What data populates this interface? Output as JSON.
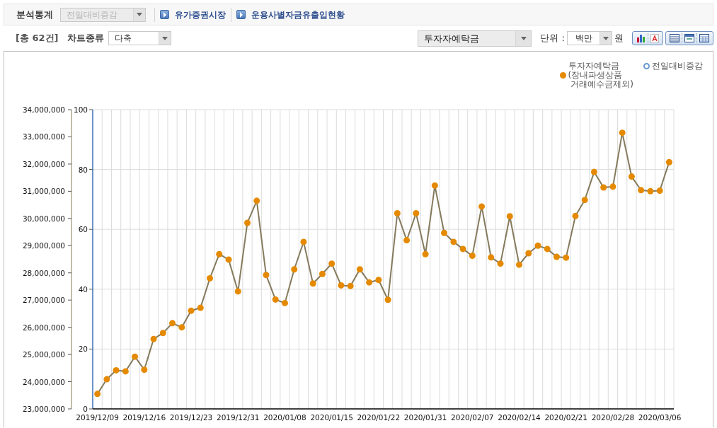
{
  "toolbar": {
    "label": "분석통계",
    "stat_select": {
      "value": "전일대비증감",
      "disabled": true
    },
    "links": [
      "유가증권시장",
      "운용사별자금유출입현황"
    ]
  },
  "controls": {
    "count": "[총 62건]",
    "chart_type_label": "차트종류",
    "chart_type": "다축",
    "metric": "투자자예탁금",
    "unit_label": "단위 :",
    "unit": "백만",
    "currency": "원"
  },
  "chart": {
    "legend": [
      {
        "kind": "hollow",
        "label": "전일대비증감",
        "color": "#6a9ad0"
      }
    ],
    "chart_data": {
      "type": "line",
      "grid": true,
      "categories": [
        "2019/12/09",
        null,
        null,
        null,
        null,
        "2019/12/16",
        null,
        null,
        null,
        null,
        "2019/12/23",
        null,
        null,
        null,
        null,
        "2019/12/31",
        null,
        null,
        null,
        null,
        "2020/01/08",
        null,
        null,
        null,
        null,
        "2020/01/15",
        null,
        null,
        null,
        null,
        "2020/01/22",
        null,
        null,
        null,
        null,
        "2020/01/31",
        null,
        null,
        null,
        null,
        "2020/02/07",
        null,
        null,
        null,
        null,
        "2020/02/14",
        null,
        null,
        null,
        null,
        "2020/02/21",
        null,
        null,
        null,
        null,
        "2020/02/28",
        null,
        null,
        null,
        null,
        "2020/03/06",
        null
      ],
      "ylim": [
        23000000,
        34000000
      ],
      "yticks": [
        {
          "value": 23000000,
          "label": "23,000,000"
        },
        {
          "value": 24000000,
          "label": "24,000,000"
        },
        {
          "value": 25000000,
          "label": "25,000,000"
        },
        {
          "value": 26000000,
          "label": "26,000,000"
        },
        {
          "value": 27000000,
          "label": "27,000,000"
        },
        {
          "value": 28000000,
          "label": "28,000,000"
        },
        {
          "value": 29000000,
          "label": "29,000,000"
        },
        {
          "value": 30000000,
          "label": "30,000,000"
        },
        {
          "value": 31000000,
          "label": "31,000,000"
        },
        {
          "value": 32000000,
          "label": "32,000,000"
        },
        {
          "value": 33000000,
          "label": "33,000,000"
        },
        {
          "value": 34000000,
          "label": "34,000,000"
        }
      ],
      "y2lim": [
        0,
        100
      ],
      "y2ticks": [
        0,
        20,
        40,
        60,
        80,
        100
      ],
      "series": [
        {
          "name": "투자자예탁금\n(장내파생상품\n 거래예수금제외)",
          "color": "#e58a00",
          "marker": "circle",
          "values": [
            23550000,
            24090000,
            24420000,
            24380000,
            24920000,
            24440000,
            25570000,
            25790000,
            26150000,
            26000000,
            26610000,
            26720000,
            27800000,
            28690000,
            28490000,
            27320000,
            29840000,
            30650000,
            27920000,
            27020000,
            26890000,
            28130000,
            29140000,
            27610000,
            27960000,
            28340000,
            27540000,
            27520000,
            28130000,
            27650000,
            27740000,
            27010000,
            30190000,
            29200000,
            30190000,
            28690000,
            31210000,
            29470000,
            29140000,
            28880000,
            28630000,
            30440000,
            28570000,
            28340000,
            30080000,
            28300000,
            28720000,
            29000000,
            28880000,
            28590000,
            28560000,
            30090000,
            30680000,
            31710000,
            31140000,
            31170000,
            33150000,
            31540000,
            31040000,
            31000000,
            31020000,
            32070000
          ]
        }
      ]
    }
  }
}
